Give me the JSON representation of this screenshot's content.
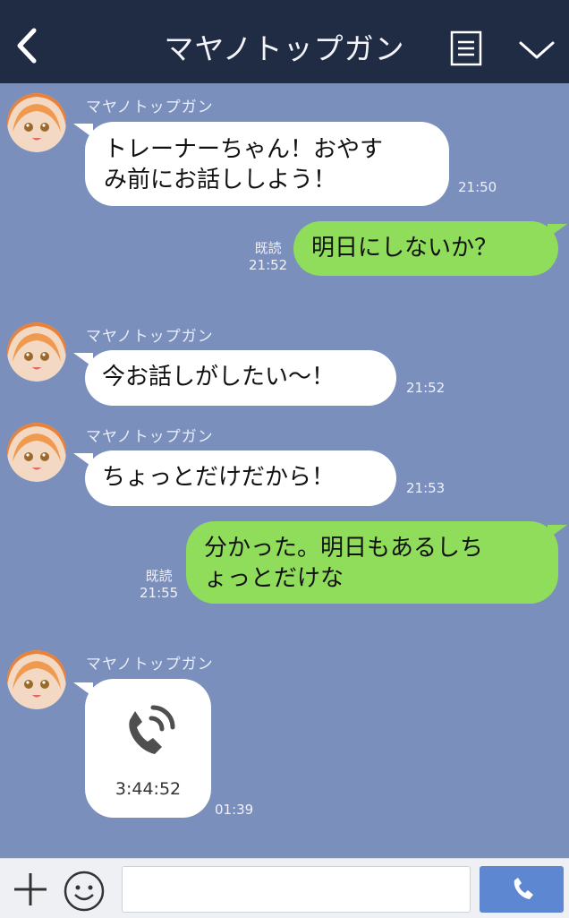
{
  "header": {
    "title": "マヤノトップガン",
    "back_icon": "chevron-left-icon",
    "menu_icon": "notes-icon",
    "more_icon": "chevron-down-icon"
  },
  "messages": [
    {
      "direction": "in",
      "sender": "マヤノトップガン",
      "lines": [
        "トレーナーちゃん！おやす",
        "み前にお話ししよう！"
      ],
      "time": "21:50"
    },
    {
      "direction": "out",
      "read": "既読",
      "lines": [
        "明日にしないか？"
      ],
      "time": "21:52"
    },
    {
      "direction": "in",
      "sender": "マヤノトップガン",
      "lines": [
        "今お話しがしたい〜！"
      ],
      "time": "21:52"
    },
    {
      "direction": "in",
      "sender": "マヤノトップガン",
      "lines": [
        "ちょっとだけだから！"
      ],
      "time": "21:53"
    },
    {
      "direction": "out",
      "read": "既読",
      "lines": [
        "分かった。明日もあるしち",
        "ょっとだけな"
      ],
      "time": "21:55"
    },
    {
      "direction": "in",
      "sender": "マヤノトップガン",
      "type": "call",
      "duration": "3:44:52",
      "time": "01:39"
    }
  ],
  "input_bar": {
    "plus_icon": "plus-icon",
    "emoji_icon": "smiley-icon",
    "message_value": "",
    "send_icon": "phone-icon"
  },
  "colors": {
    "background": "#7b8fbd",
    "header": "#202c44",
    "outgoing_bubble": "#8fdd5a",
    "incoming_bubble": "#ffffff",
    "send_button": "#5e87d2"
  }
}
